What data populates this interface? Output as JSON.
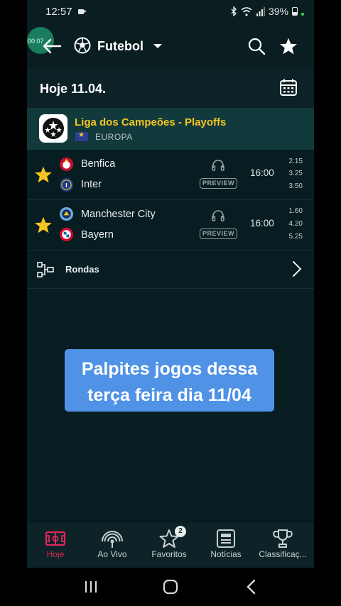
{
  "status_bar": {
    "time": "12:57",
    "battery": "39%",
    "icons": [
      "video-icon",
      "bluetooth-icon",
      "wifi-icon",
      "signal-icon",
      "battery-icon"
    ]
  },
  "screen_recorder": {
    "elapsed": "00:07"
  },
  "header": {
    "sport": "Futebol",
    "icons": [
      "back-arrow-icon",
      "soccer-ball-icon",
      "dropdown-caret-icon",
      "search-icon",
      "star-icon"
    ]
  },
  "date_bar": {
    "label": "Hoje 11.04.",
    "icon": "calendar-icon"
  },
  "league": {
    "name": "Liga dos Campeões - Playoffs",
    "country": "EUROPA",
    "icons": [
      "champions-league-logo",
      "europe-flag-icon"
    ]
  },
  "matches": [
    {
      "home": "Benfica",
      "away": "Inter",
      "time": "16:00",
      "badge": "PREVIEW",
      "odds": [
        "2.15",
        "3.25",
        "3.50"
      ],
      "home_color": "#c8102e",
      "away_color": "#1e3a8a",
      "favorite": true
    },
    {
      "home": "Manchester City",
      "away": "Bayern",
      "time": "16:00",
      "badge": "PREVIEW",
      "odds": [
        "1.60",
        "4.20",
        "5.25"
      ],
      "home_color": "#6cabdd",
      "away_color": "#dc052d",
      "favorite": true
    }
  ],
  "rondas": {
    "label": "Rondas",
    "icon": "bracket-icon"
  },
  "caption": {
    "line1": "Palpites jogos dessa",
    "line2": "terça feira dia 11/04"
  },
  "bottom_nav": {
    "items": [
      {
        "label": "Hoje",
        "icon": "pitch-icon",
        "active": true
      },
      {
        "label": "Ao Vivo",
        "icon": "live-icon",
        "active": false
      },
      {
        "label": "Favoritos",
        "icon": "star-outline-icon",
        "active": false,
        "badge": "2"
      },
      {
        "label": "Notícias",
        "icon": "news-icon",
        "active": false
      },
      {
        "label": "Classificaç...",
        "icon": "trophy-icon",
        "active": false
      }
    ]
  },
  "system_nav": {
    "icons": [
      "recents-icon",
      "home-icon",
      "back-icon"
    ]
  },
  "colors": {
    "background": "#081d21",
    "league_bar": "#123a3c",
    "league_name": "#f3c623",
    "favorite_star": "#f3c623",
    "active_tab": "#e3265b",
    "caption_bg": "#4f92e6"
  }
}
